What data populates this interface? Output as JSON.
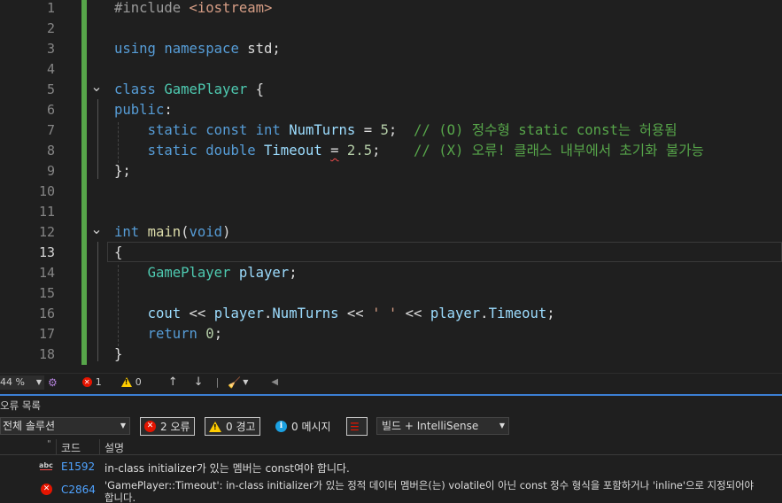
{
  "editor": {
    "active_line": "13",
    "lines": [
      {
        "n": "1",
        "fold": false,
        "segs": [
          [
            "pp",
            "#include "
          ],
          [
            "str",
            "<iostream>"
          ]
        ]
      },
      {
        "n": "2",
        "fold": false,
        "segs": []
      },
      {
        "n": "3",
        "fold": false,
        "segs": [
          [
            "kw",
            "using"
          ],
          [
            "",
            " "
          ],
          [
            "kw",
            "namespace"
          ],
          [
            "",
            " std;"
          ]
        ]
      },
      {
        "n": "4",
        "fold": false,
        "segs": []
      },
      {
        "n": "5",
        "fold": true,
        "segs": [
          [
            "kw",
            "class"
          ],
          [
            "",
            " "
          ],
          [
            "type",
            "GamePlayer"
          ],
          [
            "",
            " {"
          ]
        ]
      },
      {
        "n": "6",
        "fold": false,
        "segs": [
          [
            "kw",
            "public"
          ],
          [
            "",
            ":"
          ]
        ]
      },
      {
        "n": "7",
        "fold": false,
        "segs": [
          [
            "",
            "    "
          ],
          [
            "kw",
            "static"
          ],
          [
            "",
            " "
          ],
          [
            "kw",
            "const"
          ],
          [
            "",
            " "
          ],
          [
            "kw",
            "int"
          ],
          [
            "",
            " "
          ],
          [
            "id",
            "NumTurns"
          ],
          [
            "",
            " = "
          ],
          [
            "num",
            "5"
          ],
          [
            "",
            ";  "
          ],
          [
            "cm",
            "// (O) 정수형 static const는 허용됨"
          ]
        ]
      },
      {
        "n": "8",
        "fold": false,
        "segs": [
          [
            "",
            "    "
          ],
          [
            "kw",
            "static"
          ],
          [
            "",
            " "
          ],
          [
            "kw",
            "double"
          ],
          [
            "",
            " "
          ],
          [
            "id",
            "Timeout"
          ],
          [
            "",
            " "
          ],
          [
            "squig",
            "="
          ],
          [
            "",
            " "
          ],
          [
            "num",
            "2.5"
          ],
          [
            "",
            ";    "
          ],
          [
            "cm",
            "// (X) 오류! 클래스 내부에서 초기화 불가능"
          ]
        ]
      },
      {
        "n": "9",
        "fold": false,
        "segs": [
          [
            "",
            "};"
          ]
        ]
      },
      {
        "n": "10",
        "fold": false,
        "segs": []
      },
      {
        "n": "11",
        "fold": false,
        "segs": []
      },
      {
        "n": "12",
        "fold": true,
        "segs": [
          [
            "kw",
            "int"
          ],
          [
            "",
            " "
          ],
          [
            "fn",
            "main"
          ],
          [
            "",
            "("
          ],
          [
            "kw",
            "void"
          ],
          [
            "",
            ")"
          ]
        ]
      },
      {
        "n": "13",
        "fold": false,
        "segs": [
          [
            "",
            "{"
          ]
        ]
      },
      {
        "n": "14",
        "fold": false,
        "segs": [
          [
            "",
            "    "
          ],
          [
            "type",
            "GamePlayer"
          ],
          [
            "",
            " "
          ],
          [
            "id",
            "player"
          ],
          [
            "",
            ";"
          ]
        ]
      },
      {
        "n": "15",
        "fold": false,
        "segs": []
      },
      {
        "n": "16",
        "fold": false,
        "segs": [
          [
            "",
            "    "
          ],
          [
            "id",
            "cout"
          ],
          [
            "",
            " << "
          ],
          [
            "id",
            "player"
          ],
          [
            "",
            "."
          ],
          [
            "id",
            "NumTurns"
          ],
          [
            "",
            " << "
          ],
          [
            "str",
            "' '"
          ],
          [
            "",
            " << "
          ],
          [
            "id",
            "player"
          ],
          [
            "",
            "."
          ],
          [
            "id",
            "Timeout"
          ],
          [
            "",
            ";"
          ]
        ]
      },
      {
        "n": "17",
        "fold": false,
        "segs": [
          [
            "",
            "    "
          ],
          [
            "kw",
            "return"
          ],
          [
            "",
            " "
          ],
          [
            "num",
            "0"
          ],
          [
            "",
            ";"
          ]
        ]
      },
      {
        "n": "18",
        "fold": false,
        "segs": [
          [
            "",
            "}"
          ]
        ]
      }
    ]
  },
  "editor_status": {
    "zoom": "44 %",
    "errors": "1",
    "warnings": "0",
    "up_arrow": "↑",
    "down_arrow": "↓",
    "separator": "|"
  },
  "error_list": {
    "title": "오류 목록",
    "scope": "전체 솔루션",
    "filter_errors": "2 오류",
    "filter_warnings": "0 경고",
    "filter_messages": "0 메시지",
    "source": "빌드 + IntelliSense",
    "columns": {
      "code": "코드",
      "description": "설명"
    },
    "rows": [
      {
        "icon": "abc",
        "code": "E1592",
        "description": "in-class initializer가 있는 멤버는 const여야 합니다."
      },
      {
        "icon": "error",
        "code": "C2864",
        "description": "'GamePlayer::Timeout': in-class initializer가 있는 정적 데이터 멤버은(는) volatile이 아닌 const 정수 형식을 포함하거나 'inline'으로 지정되어야",
        "description_cont": "합니다."
      }
    ]
  },
  "colors": {
    "accent": "#3c7fd5",
    "change_bar": "#57a64a",
    "error": "#e51400",
    "warning": "#ffcc00",
    "info": "#1ba1e2"
  }
}
